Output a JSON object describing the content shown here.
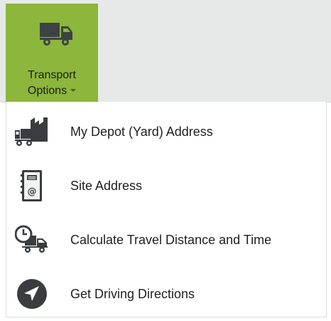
{
  "ribbon": {
    "transport_button": {
      "line1": "Transport",
      "line2": "Options",
      "icon": "truck-icon",
      "has_dropdown_arrow": true
    }
  },
  "colors": {
    "accent": "#8cb63c",
    "ribbon_background": "#e7e9e9",
    "icon_dark": "#3a3d3f",
    "text": "#1f1f1f"
  },
  "menu": {
    "items": [
      {
        "label": "My Depot (Yard) Address",
        "icon": "depot-factory-truck-icon"
      },
      {
        "label": "Site Address",
        "icon": "address-book-icon"
      },
      {
        "label": "Calculate Travel Distance and Time",
        "icon": "clock-truck-icon"
      },
      {
        "label": "Get Driving Directions",
        "icon": "navigation-arrow-icon"
      }
    ]
  }
}
